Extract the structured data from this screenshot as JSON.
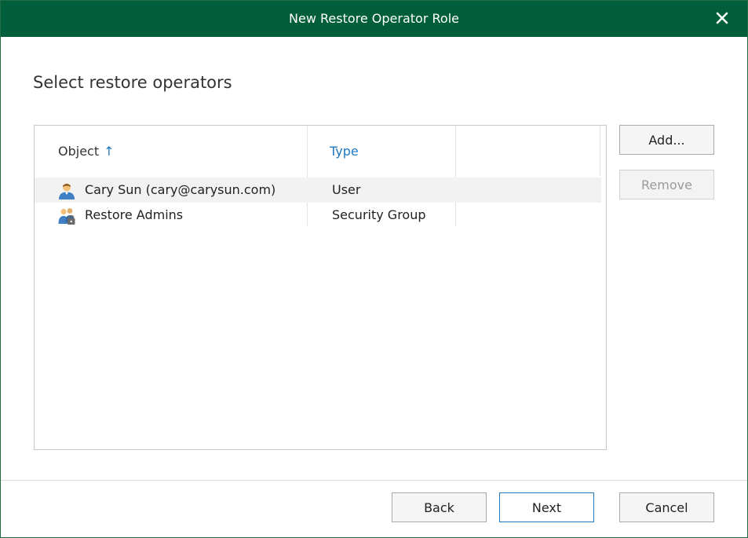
{
  "window": {
    "title": "New Restore Operator Role",
    "close_icon": "close-icon"
  },
  "page": {
    "heading": "Select restore operators"
  },
  "list": {
    "columns": [
      {
        "label": "Object",
        "sorted": "ascending"
      },
      {
        "label": "Type"
      }
    ],
    "sort_arrow": "↑",
    "rows": [
      {
        "object": "Cary Sun (cary@carysun.com)",
        "type": "User",
        "icon": "user-icon",
        "selected": true
      },
      {
        "object": "Restore Admins",
        "type": "Security Group",
        "icon": "security-group-icon",
        "selected": false
      }
    ]
  },
  "side_buttons": {
    "add": "Add...",
    "remove": "Remove"
  },
  "footer": {
    "back": "Back",
    "next": "Next",
    "cancel": "Cancel"
  },
  "colors": {
    "titlebar": "#005f3a",
    "accent": "#1f78c1"
  }
}
